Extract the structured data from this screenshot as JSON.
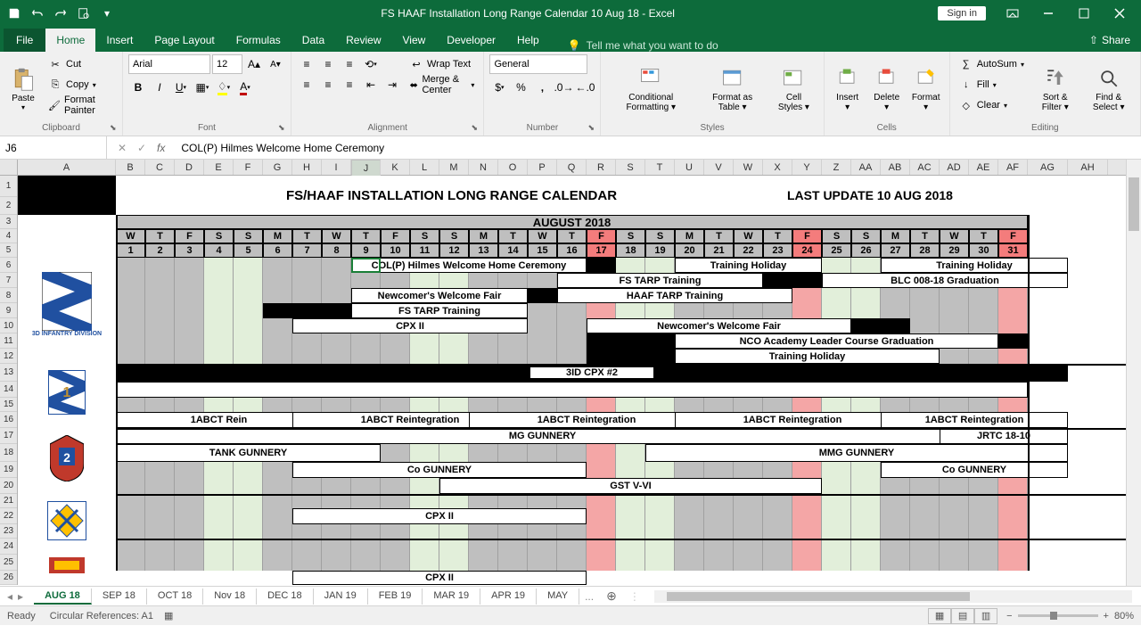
{
  "titlebar": {
    "title": "FS HAAF Installation Long Range Calendar 10 Aug 18  -  Excel",
    "signin": "Sign in"
  },
  "tabs": {
    "file": "File",
    "list": [
      "Home",
      "Insert",
      "Page Layout",
      "Formulas",
      "Data",
      "Review",
      "View",
      "Developer",
      "Help"
    ],
    "active": "Home",
    "tellme": "Tell me what you want to do",
    "share": "Share"
  },
  "ribbon": {
    "clipboard": {
      "paste": "Paste",
      "cut": "Cut",
      "copy": "Copy",
      "fp": "Format Painter",
      "label": "Clipboard"
    },
    "font": {
      "name": "Arial",
      "size": "12",
      "label": "Font"
    },
    "alignment": {
      "wrap": "Wrap Text",
      "merge": "Merge & Center",
      "label": "Alignment"
    },
    "number": {
      "format": "General",
      "label": "Number"
    },
    "styles": {
      "cf": "Conditional Formatting",
      "fat": "Format as Table",
      "cs": "Cell Styles",
      "label": "Styles"
    },
    "cells": {
      "ins": "Insert",
      "del": "Delete",
      "fmt": "Format",
      "label": "Cells"
    },
    "editing": {
      "sum": "AutoSum",
      "fill": "Fill",
      "clear": "Clear",
      "sort": "Sort & Filter",
      "find": "Find & Select",
      "label": "Editing"
    }
  },
  "formula": {
    "cell": "J6",
    "value": "COL(P) Hilmes Welcome Home Ceremony"
  },
  "columns": [
    "A",
    "B",
    "C",
    "D",
    "E",
    "F",
    "G",
    "H",
    "I",
    "J",
    "K",
    "L",
    "M",
    "N",
    "O",
    "P",
    "Q",
    "R",
    "S",
    "T",
    "U",
    "V",
    "W",
    "X",
    "Y",
    "Z",
    "AA",
    "AB",
    "AC",
    "AD",
    "AE",
    "AF",
    "AG",
    "AH"
  ],
  "title_row": {
    "main": "FS/HAAF INSTALLATION LONG RANGE CALENDAR",
    "update": "LAST UPDATE 10 AUG 2018"
  },
  "month": "AUGUST 2018",
  "dow": [
    "W",
    "T",
    "F",
    "S",
    "S",
    "M",
    "T",
    "W",
    "T",
    "F",
    "S",
    "S",
    "M",
    "T",
    "W",
    "T",
    "F",
    "S",
    "S",
    "M",
    "T",
    "W",
    "T",
    "F",
    "S",
    "S",
    "M",
    "T",
    "W",
    "T",
    "F"
  ],
  "days": [
    1,
    2,
    3,
    4,
    5,
    6,
    7,
    8,
    9,
    10,
    11,
    12,
    13,
    14,
    15,
    16,
    17,
    18,
    19,
    20,
    21,
    22,
    23,
    24,
    25,
    26,
    27,
    28,
    29,
    30,
    31
  ],
  "events": {
    "e1": "COL(P) Hilmes Welcome Home Ceremony",
    "e2": "Training Holiday",
    "e3": "Training Holiday",
    "e4": "FS TARP Training",
    "e5": "BLC 008-18 Graduation",
    "e6": "Newcomer's Welcome Fair",
    "e7": "HAAF TARP Training",
    "e8": "FS TARP Training",
    "e9": "CPX II",
    "e10": "Newcomer's Welcome Fair",
    "e11": "NCO Academy Leader Course Graduation",
    "e12": "Training Holiday",
    "e13": "3ID CPX #2",
    "e14": "1ABCT Rein",
    "e15": "1ABCT Reintegration",
    "e16": "1ABCT Reintegration",
    "e17": "1ABCT Reintegration",
    "e18": "1ABCT Reintegration",
    "e19": "MG GUNNERY",
    "e20": "JRTC 18-10",
    "e21": "TANK GUNNERY",
    "e22": "MMG GUNNERY",
    "e23": "Co GUNNERY",
    "e24": "Co GUNNERY",
    "e25": "GST V-VI",
    "e26": "CPX II",
    "e27": "CPX II"
  },
  "logo1": "3D INFANTRY DIVISION",
  "sheet_tabs": [
    "AUG 18",
    "SEP 18",
    "OCT 18",
    "Nov 18",
    "DEC 18",
    "JAN 19",
    "FEB 19",
    "MAR 19",
    "APR 19",
    "MAY"
  ],
  "active_sheet": "AUG 18",
  "status": {
    "ready": "Ready",
    "circ": "Circular References: A1",
    "zoom": "80%"
  }
}
